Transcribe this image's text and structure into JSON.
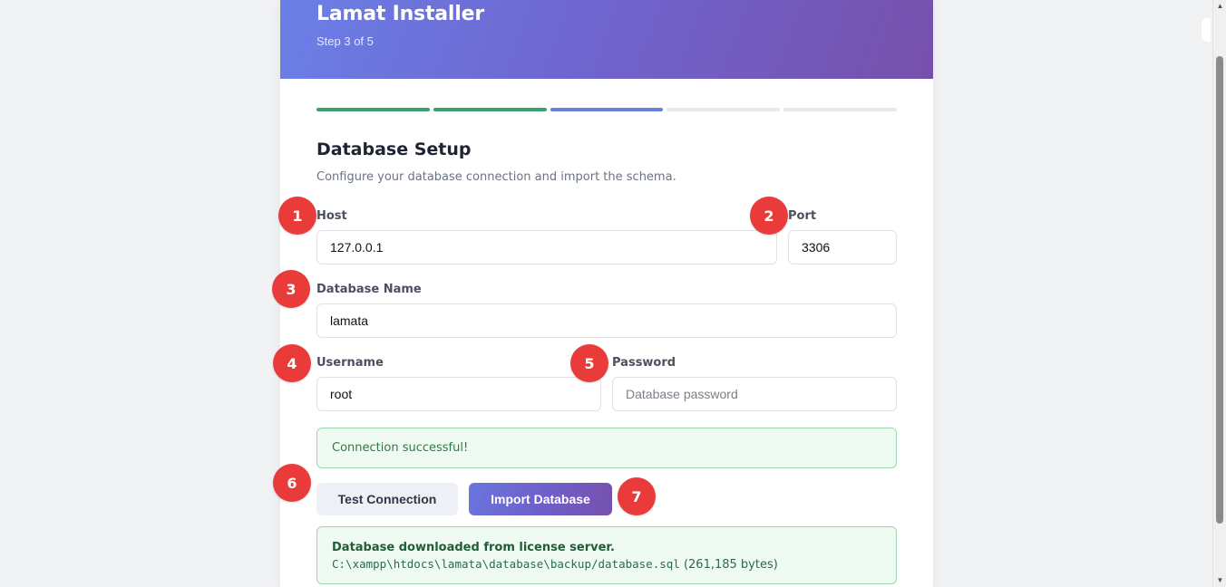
{
  "installer": {
    "app_title": "Lamat Installer",
    "step_label": "Step 3 of 5",
    "progress": {
      "total_steps": 5,
      "completed_steps": 2,
      "current_step": 3
    }
  },
  "section": {
    "title": "Database Setup",
    "description": "Configure your database connection and import the schema."
  },
  "form": {
    "host": {
      "label": "Host",
      "value": "127.0.0.1"
    },
    "port": {
      "label": "Port",
      "value": "3306"
    },
    "database_name": {
      "label": "Database Name",
      "value": "lamata"
    },
    "username": {
      "label": "Username",
      "value": "root"
    },
    "password": {
      "label": "Password",
      "value": "",
      "placeholder": "Database password"
    }
  },
  "connection_alert": {
    "message": "Connection successful!"
  },
  "buttons": {
    "test_connection": "Test Connection",
    "import_database": "Import Database"
  },
  "download_alert": {
    "title": "Database downloaded from license server.",
    "path": "C:\\xampp\\htdocs\\lamata\\database\\backup/database.sql",
    "size": "(261,185 bytes)"
  },
  "markers": [
    "1",
    "2",
    "3",
    "4",
    "5",
    "6",
    "7"
  ],
  "colors": {
    "header_gradient_start": "#6a80e6",
    "header_gradient_end": "#7650ab",
    "step_done": "#3f9f73",
    "step_current": "#6a80d8",
    "success_bg": "#effbf2",
    "marker": "#ea3b3b"
  },
  "scrollbar": {
    "icons": [
      "scroll-up-arrow-icon",
      "scroll-down-arrow-icon"
    ]
  }
}
